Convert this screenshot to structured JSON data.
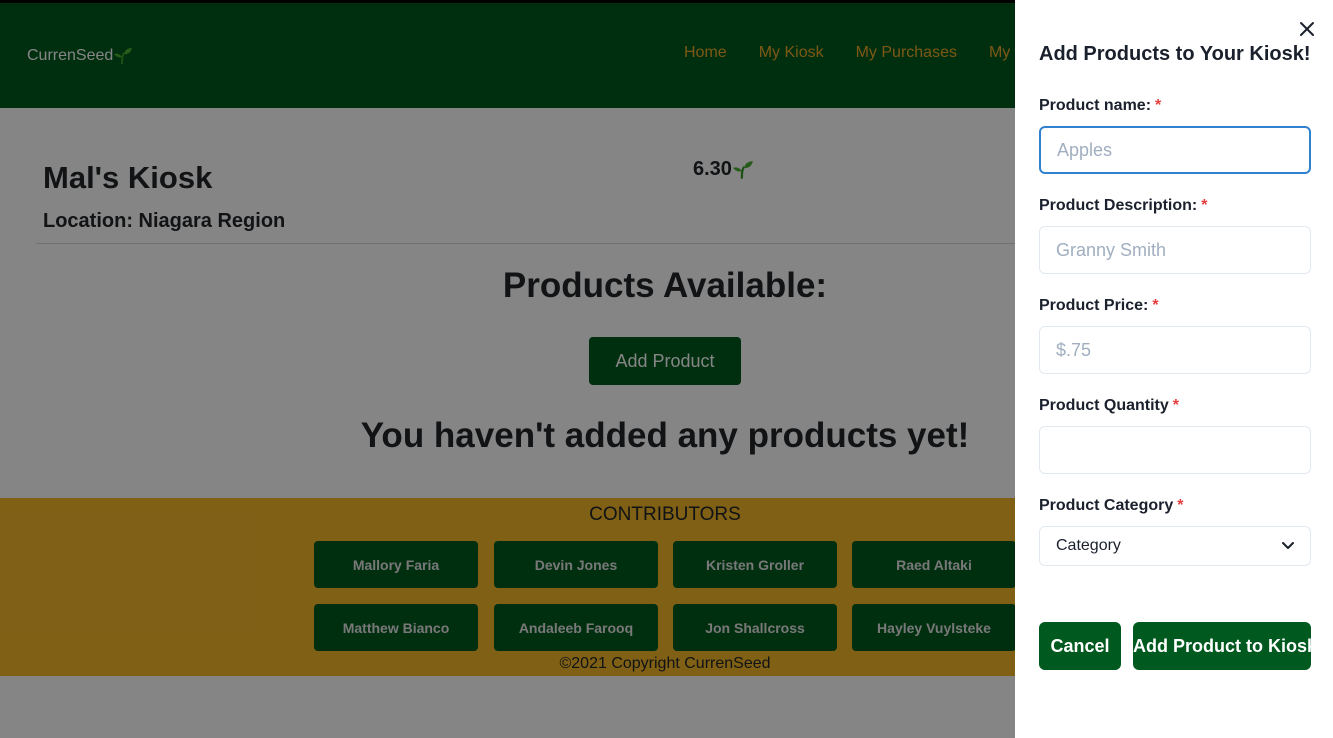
{
  "navbar": {
    "brand": "CurrenSeed",
    "links": [
      "Home",
      "My Kiosk",
      "My Purchases",
      "My"
    ]
  },
  "kiosk": {
    "name": "Mal's Kiosk",
    "location": "Location: Niagara Region",
    "balance": "6.30"
  },
  "main": {
    "products_title": "Products Available:",
    "add_product_label": "Add Product",
    "empty_message": "You haven't added any products yet!"
  },
  "footer": {
    "contributors_title": "CONTRIBUTORS",
    "contributors": [
      "Mallory Faria",
      "Devin Jones",
      "Kristen Groller",
      "Raed Altaki",
      "Matthew Bianco",
      "Andaleeb Farooq",
      "Jon Shallcross",
      "Hayley Vuylsteke"
    ],
    "copyright": "©2021 Copyright CurrenSeed"
  },
  "panel": {
    "title": "Add Products to Your Kiosk!",
    "fields": {
      "name": {
        "label": "Product name:",
        "placeholder": "Apples",
        "value": ""
      },
      "description": {
        "label": "Product Description:",
        "placeholder": "Granny Smith",
        "value": ""
      },
      "price": {
        "label": "Product Price:",
        "placeholder": "$.75",
        "value": ""
      },
      "quantity": {
        "label": "Product Quantity",
        "placeholder": "",
        "value": ""
      },
      "category": {
        "label": "Product Category",
        "selected": "Category"
      }
    },
    "required_mark": "*",
    "cancel_label": "Cancel",
    "submit_label": "Add Product to Kiosk"
  },
  "colors": {
    "primary_green": "#005a1f",
    "nav_link": "#f0a92a",
    "footer_yellow": "#f4b92a",
    "required_red": "#e53e3e",
    "focus_blue": "#3182ce"
  },
  "icons": [
    "sprout-icon",
    "close-icon",
    "chevron-down-icon"
  ]
}
